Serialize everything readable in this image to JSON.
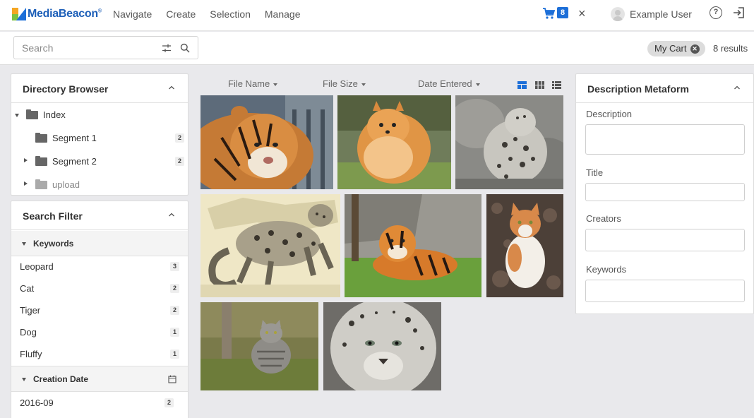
{
  "header": {
    "logo_text": "MediaBeacon",
    "logo_mark": "®",
    "nav": [
      "Navigate",
      "Create",
      "Selection",
      "Manage"
    ],
    "cart_count": "8",
    "user_name": "Example User"
  },
  "searchbar": {
    "placeholder": "Search",
    "my_cart_label": "My Cart",
    "results_text": "8 results"
  },
  "directory": {
    "title": "Directory Browser",
    "items": [
      {
        "label": "Index",
        "count": ""
      },
      {
        "label": "Segment 1",
        "count": "2"
      },
      {
        "label": "Segment 2",
        "count": "2"
      },
      {
        "label": "upload",
        "count": ""
      }
    ]
  },
  "search_filter": {
    "title": "Search Filter",
    "keywords_title": "Keywords",
    "keywords": [
      {
        "label": "Leopard",
        "count": "3"
      },
      {
        "label": "Cat",
        "count": "2"
      },
      {
        "label": "Tiger",
        "count": "2"
      },
      {
        "label": "Dog",
        "count": "1"
      },
      {
        "label": "Fluffy",
        "count": "1"
      }
    ],
    "creation_date_title": "Creation Date",
    "dates": [
      {
        "label": "2016-09",
        "count": "2"
      }
    ]
  },
  "results_header": {
    "sort_file_name": "File Name",
    "sort_file_size": "File Size",
    "sort_date_entered": "Date Entered"
  },
  "metaform": {
    "title": "Description Metaform",
    "fields": [
      {
        "label": "Description",
        "value": ""
      },
      {
        "label": "Title",
        "value": ""
      },
      {
        "label": "Creators",
        "value": ""
      },
      {
        "label": "Keywords",
        "value": ""
      }
    ]
  },
  "colors": {
    "accent": "#1d6fd8",
    "background": "#e9e9ec"
  }
}
